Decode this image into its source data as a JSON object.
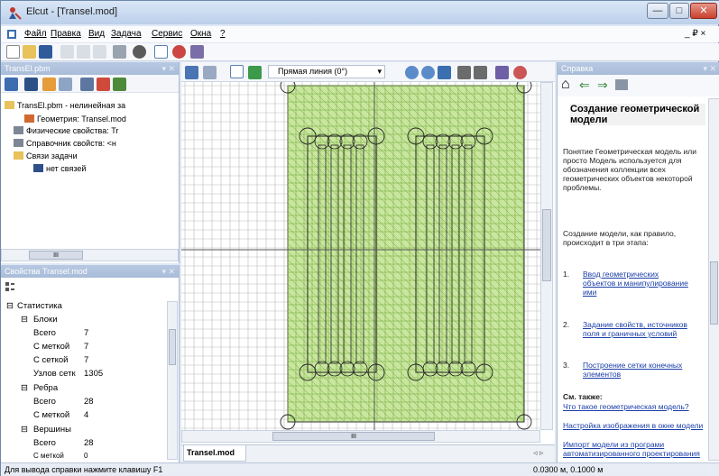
{
  "window": {
    "title": "Elcut - [Transel.mod]",
    "minimize": "—",
    "maximize": "□",
    "close": "✕"
  },
  "menu": {
    "items": [
      "Файл",
      "Правка",
      "Вид",
      "Задача",
      "Сервис",
      "Окна",
      "?"
    ],
    "mdi_controls": "_ ₽ ×"
  },
  "toolbar": {
    "line_mode": "Прямая линия (0°)"
  },
  "problem_panel": {
    "header": "TransEl.pbm",
    "root": "TransEl.pbm - нелинейная за",
    "geometry": "Геометрия: Transel.mod",
    "physics": "Физические свойства: Tr",
    "library": "Справочник свойств: <н",
    "links": "Связи задачи",
    "no_links": "нет связей",
    "hscroll_thumb": "III"
  },
  "props_panel": {
    "header": "Свойства Transel.mod",
    "stats": "Статистика",
    "blocks": "Блоки",
    "blocks_total_label": "Всего",
    "blocks_total": "7",
    "blocks_labeled_label": "С меткой",
    "blocks_labeled": "7",
    "blocks_mesh_label": "С сеткой",
    "blocks_mesh": "7",
    "nodes_label": "Узлов сетк",
    "nodes": "1305",
    "edges": "Ребра",
    "edges_total_label": "Всего",
    "edges_total": "28",
    "edges_labeled_label": "С меткой",
    "edges_labeled": "4",
    "vertices": "Вершины",
    "vert_total_label": "Всего",
    "vert_total": "28",
    "vert_labeled_label": "С меткой",
    "vert_labeled": "0"
  },
  "canvas": {
    "tab": "Transel.mod",
    "hscroll_thumb": "III"
  },
  "help": {
    "header": "Справка",
    "title": "Создание геометрической модели",
    "p1": "Понятие Геометрическая модель или просто Модель используется для обозначения коллекции всех геометрических объектов некоторой проблемы.",
    "p2": "Создание модели, как правило, происходит в три этапа:",
    "items": [
      {
        "num": "1.",
        "text": "Ввод геометрических объектов и манипулирование ими"
      },
      {
        "num": "2.",
        "text": "Задание свойств, источников поля и граничных условий"
      },
      {
        "num": "3.",
        "text": "Построение сетки конечных элементов"
      }
    ],
    "see_also": "См. также:",
    "links": [
      "Что такое геометрическая модель?",
      "Настройка изображения в окне модели",
      "Импорт модели из програми автоматизированного проектирования"
    ]
  },
  "status": {
    "hint": "Для вывода справки нажмите клавишу F1",
    "coords": "0.0300 м, 0.1000 м"
  },
  "colors": {
    "mesh": "#6fa832",
    "mesh_fill": "#c9e6a0",
    "grid": "#b9b9b9",
    "panel_header": "#aabfdc"
  }
}
